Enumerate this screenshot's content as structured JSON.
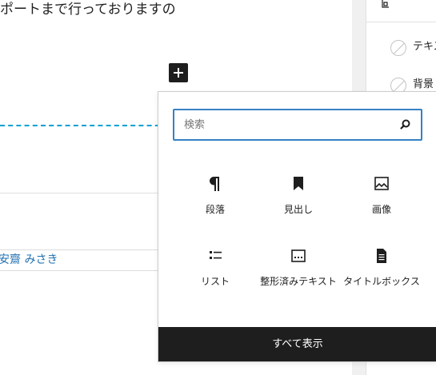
{
  "editor": {
    "paragraph_text": "ポートまで行っておりますの",
    "author_name": "安齋 みさき"
  },
  "sidebar": {
    "items": [
      {
        "label": "テキスト",
        "icon": "no-color-swatch-icon"
      },
      {
        "label": "背景",
        "icon": "no-color-swatch-icon"
      }
    ]
  },
  "inserter": {
    "search_placeholder": "検索",
    "blocks": [
      {
        "label": "段落",
        "icon": "paragraph-icon"
      },
      {
        "label": "見出し",
        "icon": "heading-bookmark-icon"
      },
      {
        "label": "画像",
        "icon": "image-icon"
      },
      {
        "label": "リスト",
        "icon": "list-icon"
      },
      {
        "label": "整形済みテキスト",
        "icon": "preformatted-icon"
      },
      {
        "label": "タイトルボックス",
        "icon": "document-icon"
      }
    ],
    "show_all_label": "すべて表示"
  },
  "colors": {
    "accent": "#3582c4",
    "dashed_guide": "#00a0d2",
    "link": "#2271b1",
    "dark": "#1e1e1e"
  }
}
